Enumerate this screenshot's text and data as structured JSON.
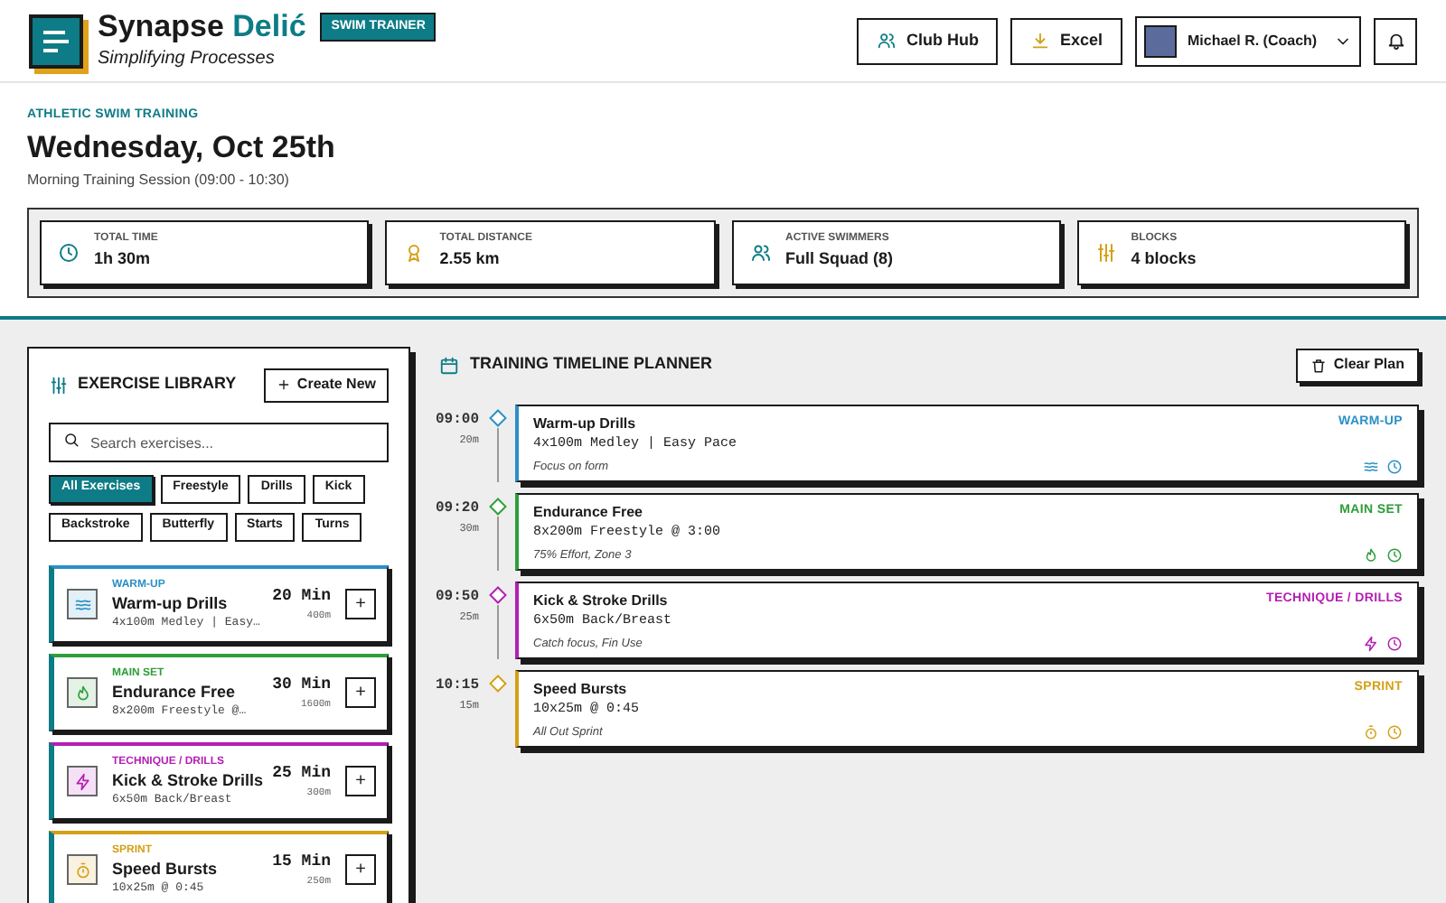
{
  "brand": {
    "name": "Synapse",
    "name_accent": "Delić",
    "tagline": "Simplifying Processes",
    "badge": "SWIM TRAINER"
  },
  "header_actions": [
    {
      "kind": "club",
      "label": "Club Hub"
    },
    {
      "kind": "excel",
      "label": "Excel"
    }
  ],
  "user": {
    "name": "Michael R. (Coach)"
  },
  "page": {
    "eyebrow": "ATHLETIC SWIM TRAINING",
    "title": "Wednesday, Oct 25th",
    "subtitle": "Morning Training Session (09:00 - 10:30)"
  },
  "stats": [
    {
      "kind": "time",
      "label": "TOTAL TIME",
      "value": "1h 30m"
    },
    {
      "kind": "distance",
      "label": "TOTAL DISTANCE",
      "value": "2.55 km"
    },
    {
      "kind": "swimmers",
      "label": "ACTIVE SWIMMERS",
      "value": "Full Squad (8)"
    },
    {
      "kind": "blocks",
      "label": "BLOCKS",
      "value": "4 blocks"
    }
  ],
  "library": {
    "title": "EXERCISE LIBRARY",
    "create_button": "Create New",
    "search": {
      "placeholder": "Search exercises..."
    },
    "filters": [
      {
        "label": "All Exercises",
        "selected": true
      },
      {
        "label": "Freestyle",
        "selected": false
      },
      {
        "label": "Drills",
        "selected": false
      },
      {
        "label": "Kick",
        "selected": false
      },
      {
        "label": "Backstroke",
        "selected": false
      },
      {
        "label": "Butterfly",
        "selected": false
      },
      {
        "label": "Starts",
        "selected": false
      },
      {
        "label": "Turns",
        "selected": false
      }
    ],
    "exercises": [
      {
        "kind": "warmup",
        "color": "#2b8fc6",
        "category": "WARM-UP",
        "title": "Warm-up Drills",
        "detail": "4x100m Medley | Easy…",
        "duration": "20 Min",
        "distance": "400m",
        "add": "+"
      },
      {
        "kind": "main",
        "color": "#2e9e3a",
        "category": "MAIN SET",
        "title": "Endurance Free",
        "detail": "8x200m Freestyle @…",
        "duration": "30 Min",
        "distance": "1600m",
        "add": "+"
      },
      {
        "kind": "technique",
        "color": "#b31fb3",
        "category": "TECHNIQUE / DRILLS",
        "title": "Kick & Stroke Drills",
        "detail": "6x50m Back/Breast",
        "duration": "25 Min",
        "distance": "300m",
        "add": "+"
      },
      {
        "kind": "sprint",
        "color": "#d4a017",
        "category": "SPRINT",
        "title": "Speed Bursts",
        "detail": "10x25m @ 0:45",
        "duration": "15 Min",
        "distance": "250m",
        "add": "+"
      }
    ]
  },
  "timeline": {
    "title": "TRAINING TIMELINE PLANNER",
    "clear_button": "Clear Plan",
    "blocks": [
      {
        "kind": "warmup",
        "color": "#2b8fc6",
        "time": "09:00",
        "duration": "20m",
        "title": "Warm-up Drills",
        "detail": "4x100m Medley | Easy Pace",
        "note": "Focus on form",
        "category": "WARM-UP"
      },
      {
        "kind": "main",
        "color": "#2e9e3a",
        "time": "09:20",
        "duration": "30m",
        "title": "Endurance Free",
        "detail": "8x200m Freestyle @ 3:00",
        "note": "75% Effort, Zone 3",
        "category": "MAIN SET"
      },
      {
        "kind": "technique",
        "color": "#b31fb3",
        "time": "09:50",
        "duration": "25m",
        "title": "Kick & Stroke Drills",
        "detail": "6x50m Back/Breast",
        "note": "Catch focus, Fin Use",
        "category": "TECHNIQUE / DRILLS"
      },
      {
        "kind": "sprint",
        "color": "#d4a017",
        "time": "10:15",
        "duration": "15m",
        "title": "Speed Bursts",
        "detail": "10x25m @ 0:45",
        "note": "All Out Sprint",
        "category": "SPRINT"
      }
    ]
  }
}
